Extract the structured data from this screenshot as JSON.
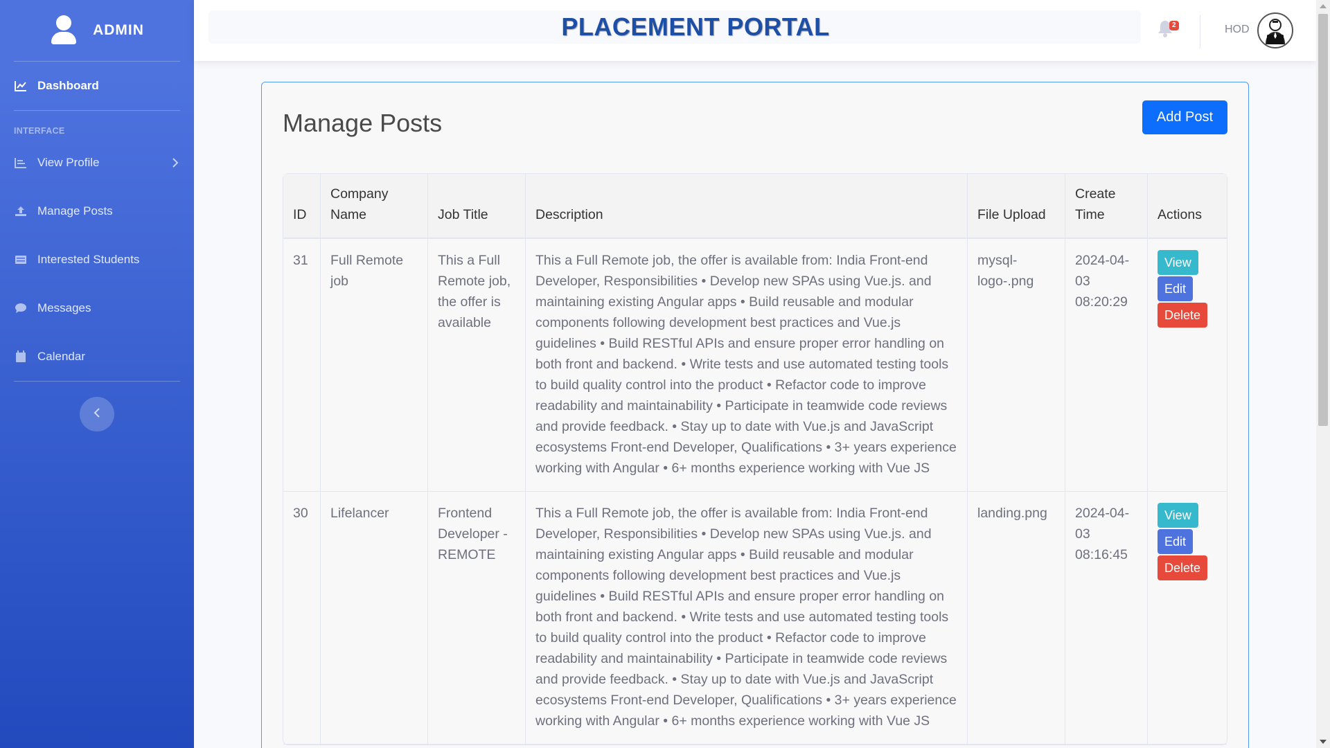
{
  "sidebar": {
    "brand": "ADMIN",
    "dashboard": "Dashboard",
    "heading": "INTERFACE",
    "items": [
      {
        "label": "View Profile",
        "icon": "profile-icon"
      },
      {
        "label": "Manage Posts",
        "icon": "upload-icon"
      },
      {
        "label": "Interested Students",
        "icon": "list-icon"
      },
      {
        "label": "Messages",
        "icon": "chat-icon"
      },
      {
        "label": "Calendar",
        "icon": "calendar-icon"
      }
    ]
  },
  "topbar": {
    "title": "PLACEMENT PORTAL",
    "notification_count": "2",
    "user": "HOD"
  },
  "main": {
    "title": "Manage Posts",
    "add_button": "Add Post",
    "columns": [
      "ID",
      "Company Name",
      "Job Title",
      "Description",
      "File Upload",
      "Create Time",
      "Actions"
    ],
    "actions": {
      "view": "View",
      "edit": "Edit",
      "delete": "Delete"
    },
    "rows": [
      {
        "id": "31",
        "company": "Full Remote job",
        "job_title": "This a Full Remote job, the offer is available",
        "description": "This a Full Remote job, the offer is available from: India Front-end Developer, Responsibilities • Develop new SPAs using Vue.js. and maintaining existing Angular apps • Build reusable and modular components following development best practices and Vue.js guidelines • Build RESTful APIs and ensure proper error handling on both front and backend. • Write tests and use automated testing tools to build quality control into the product • Refactor code to improve readability and maintainability • Participate in teamwide code reviews and provide feedback. • Stay up to date with Vue.js and JavaScript ecosystems Front-end Developer, Qualifications • 3+ years experience working with Angular • 6+ months experience working with Vue JS",
        "file": "mysql-logo-.png",
        "created": "2024-04-03 08:20:29"
      },
      {
        "id": "30",
        "company": "Lifelancer",
        "job_title": "Frontend Developer - REMOTE",
        "description": "This a Full Remote job, the offer is available from: India Front-end Developer, Responsibilities • Develop new SPAs using Vue.js. and maintaining existing Angular apps • Build reusable and modular components following development best practices and Vue.js guidelines • Build RESTful APIs and ensure proper error handling on both front and backend. • Write tests and use automated testing tools to build quality control into the product • Refactor code to improve readability and maintainability • Participate in teamwide code reviews and provide feedback. • Stay up to date with Vue.js and JavaScript ecosystems Front-end Developer, Qualifications • 3+ years experience working with Angular • 6+ months experience working with Vue JS",
        "file": "landing.png",
        "created": "2024-04-03 08:16:45"
      }
    ]
  }
}
